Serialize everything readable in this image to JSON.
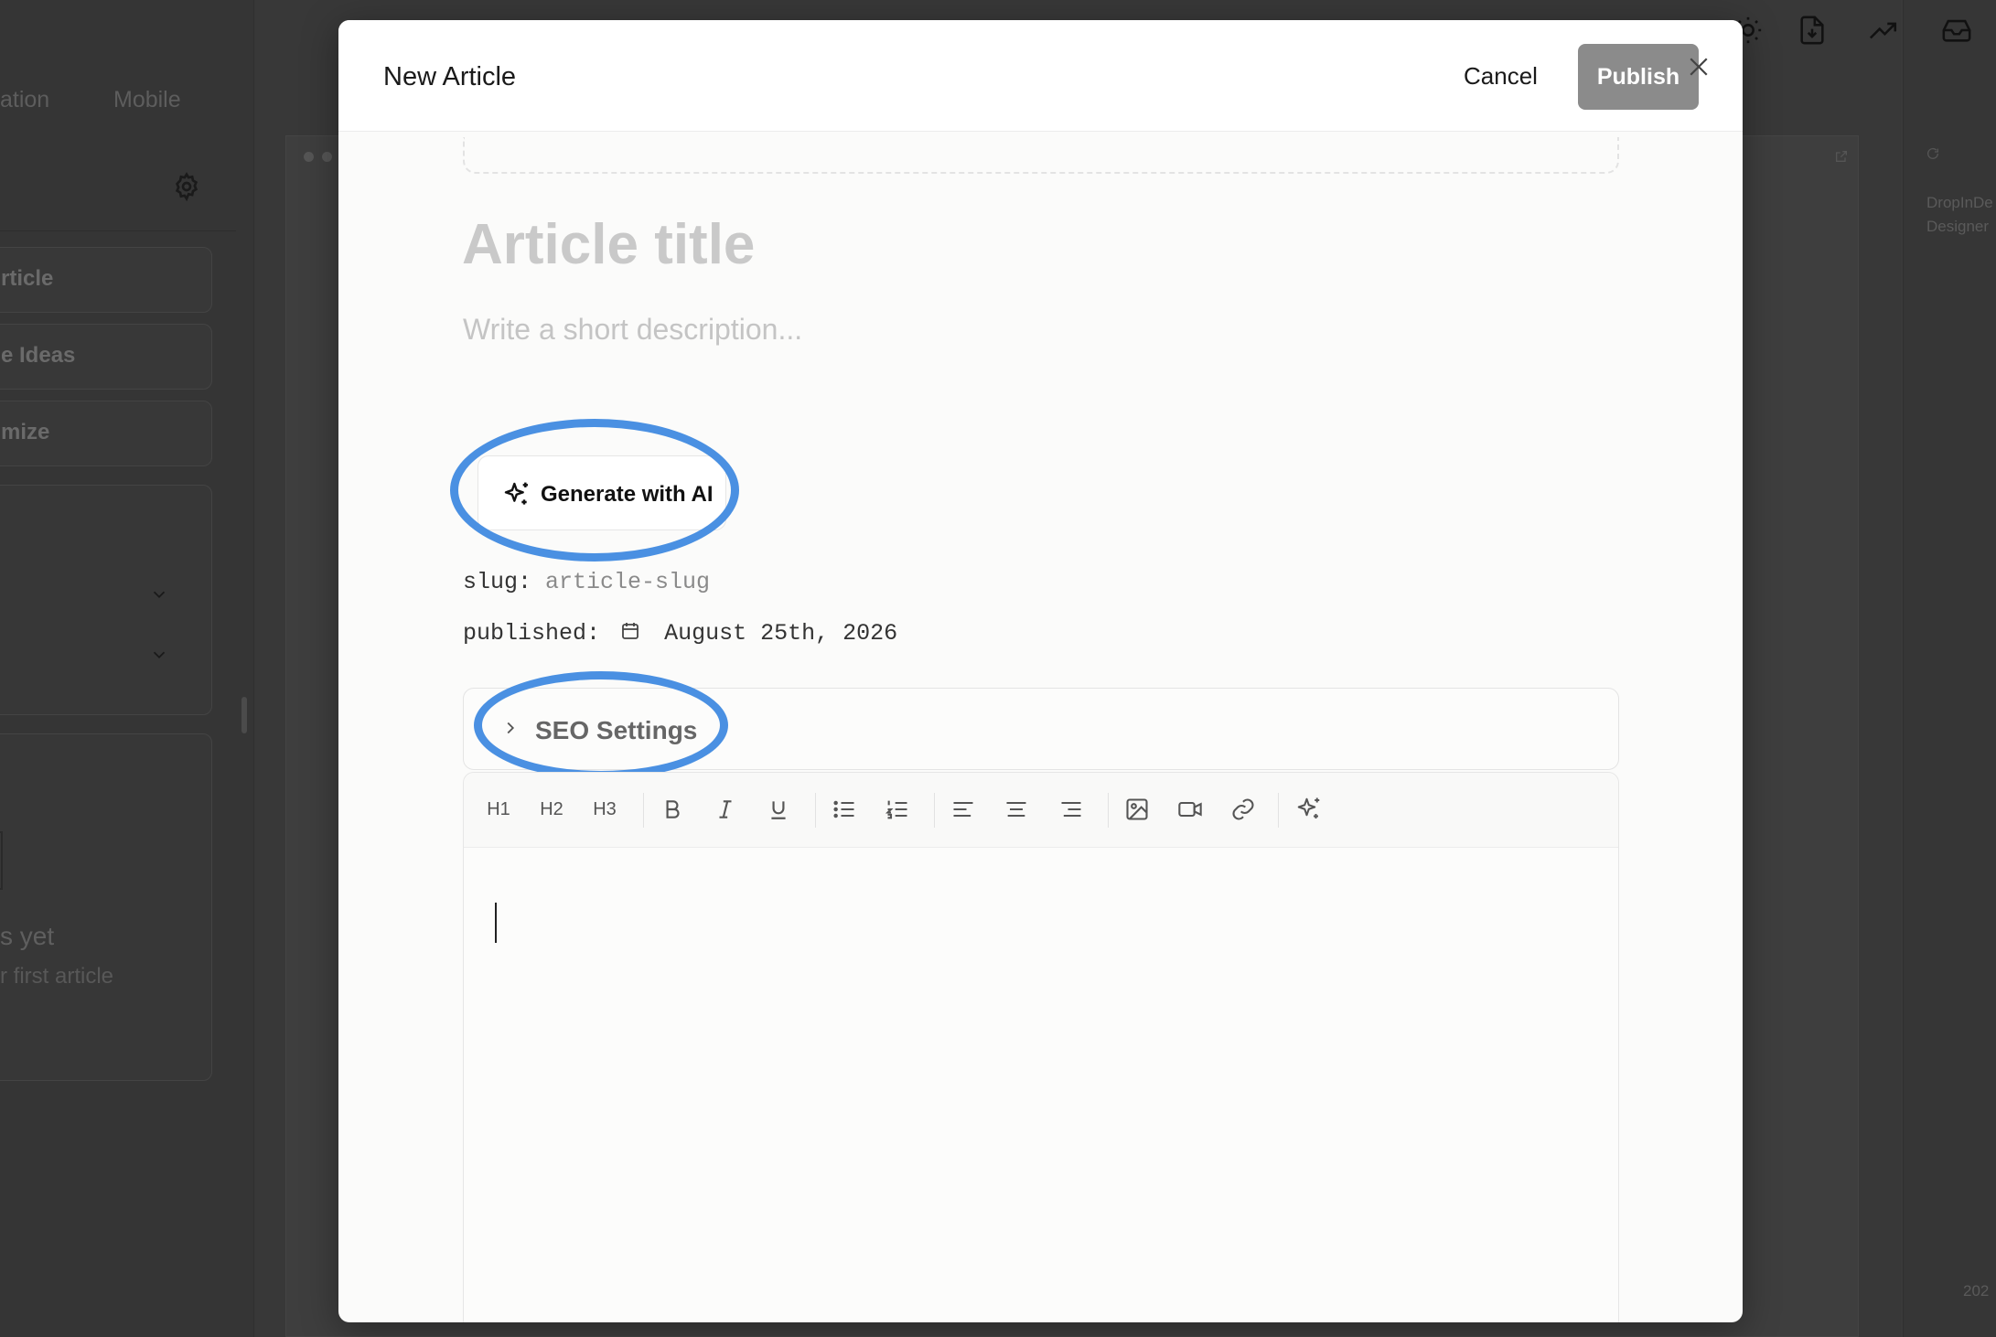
{
  "background": {
    "tabs": [
      "ation",
      "Mobile"
    ],
    "sidebar_buttons": [
      "rticle",
      "e Ideas",
      "mize"
    ],
    "empty_title": "s yet",
    "empty_subtitle": "r first article",
    "right_panel_lines": [
      "DropInDe",
      "Designer"
    ],
    "right_panel_footer": "202"
  },
  "modal": {
    "title": "New Article",
    "cancel_label": "Cancel",
    "publish_label": "Publish",
    "article_title_placeholder": "Article title",
    "description_placeholder": "Write a short description...",
    "generate_label": "Generate with AI",
    "slug_label": "slug:",
    "slug_value": "article-slug",
    "published_label": "published:",
    "published_date": "August 25th, 2026",
    "seo_label": "SEO Settings",
    "toolbar": {
      "h1": "H1",
      "h2": "H2",
      "h3": "H3"
    }
  },
  "colors": {
    "highlight": "#4a90e2",
    "publish_bg": "#8b8b8b"
  }
}
